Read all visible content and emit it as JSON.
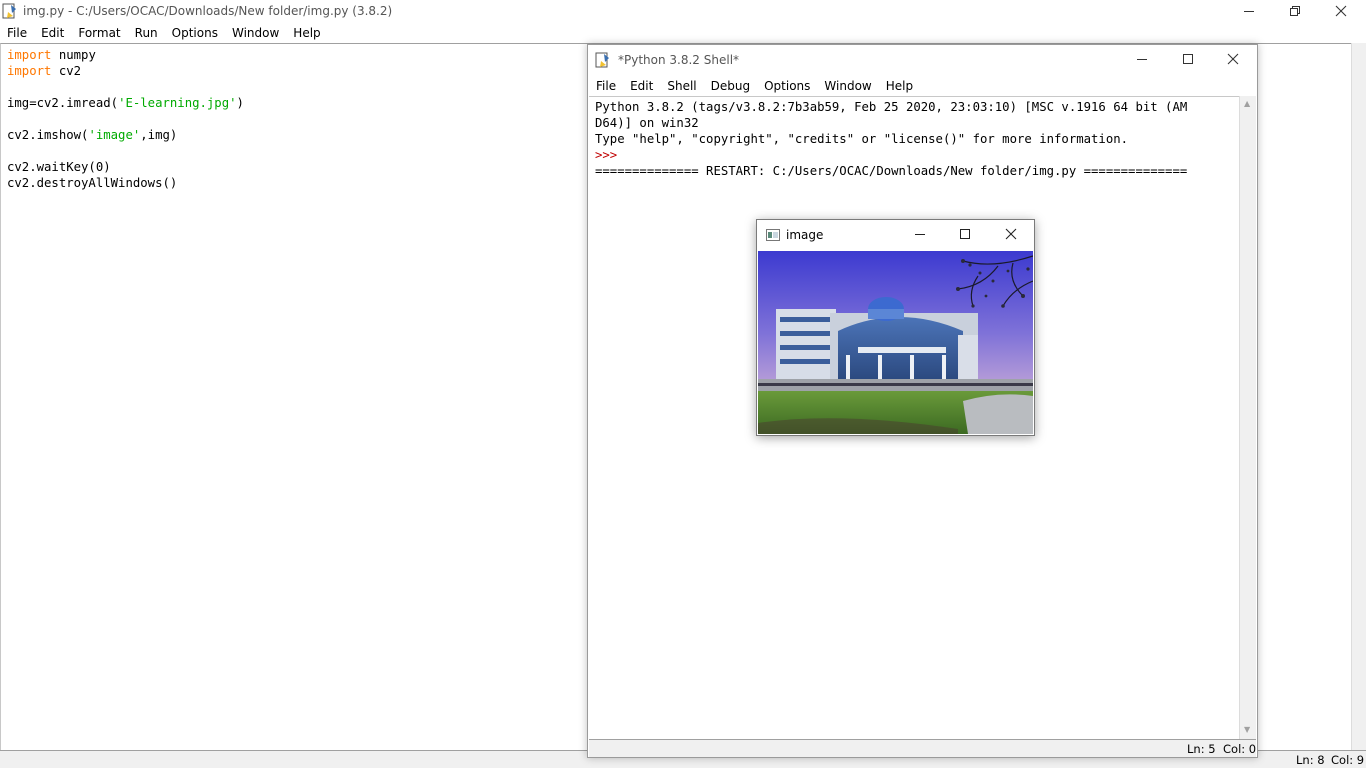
{
  "editor": {
    "title": "img.py - C:/Users/OCAC/Downloads/New folder/img.py (3.8.2)",
    "menu": [
      "File",
      "Edit",
      "Format",
      "Run",
      "Options",
      "Window",
      "Help"
    ],
    "code": {
      "line1_kw": "import",
      "line1_rest": " numpy",
      "line2_kw": "import",
      "line2_rest": " cv2",
      "line4_a": "img=cv2.imread(",
      "line4_str": "'E-learning.jpg'",
      "line4_b": ")",
      "line6_a": "cv2.imshow(",
      "line6_str": "'image'",
      "line6_b": ",img)",
      "line8": "cv2.waitKey(0)",
      "line9": "cv2.destroyAllWindows()"
    },
    "status": {
      "ln": "Ln: 8",
      "col": "Col: 9"
    }
  },
  "shell": {
    "title": "*Python 3.8.2 Shell*",
    "menu": [
      "File",
      "Edit",
      "Shell",
      "Debug",
      "Options",
      "Window",
      "Help"
    ],
    "lines": {
      "l1": "Python 3.8.2 (tags/v3.8.2:7b3ab59, Feb 25 2020, 23:03:10) [MSC v.1916 64 bit (AM",
      "l2": "D64)] on win32",
      "l3": "Type \"help\", \"copyright\", \"credits\" or \"license()\" for more information.",
      "prompt": ">>> ",
      "l5": "============== RESTART: C:/Users/OCAC/Downloads/New folder/img.py =============="
    },
    "status": {
      "ln": "Ln: 5",
      "col": "Col: 0"
    }
  },
  "image_window": {
    "title": "image"
  },
  "colors": {
    "keyword": "#ff7700",
    "string": "#00aa00",
    "prompt": "#c00000",
    "statusbar": "#f0f0f0"
  },
  "icons": [
    "python-idle-icon",
    "minimize-icon",
    "restore-icon",
    "maximize-icon",
    "close-icon",
    "opencv-window-icon"
  ]
}
